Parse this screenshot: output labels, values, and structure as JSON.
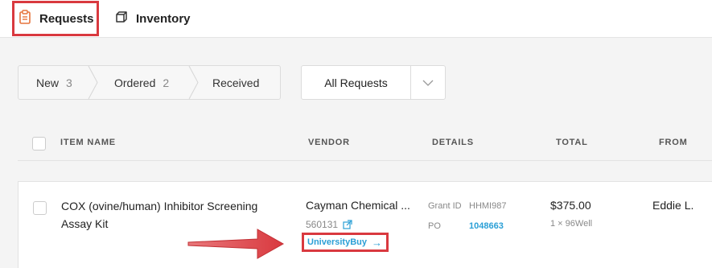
{
  "tabs": [
    {
      "label": "Requests",
      "icon": "clipboard-icon",
      "active": true
    },
    {
      "label": "Inventory",
      "icon": "box-icon",
      "active": false
    }
  ],
  "status_steps": [
    {
      "label": "New",
      "count": "3"
    },
    {
      "label": "Ordered",
      "count": "2"
    },
    {
      "label": "Received",
      "count": ""
    }
  ],
  "filter": {
    "selected": "All Requests"
  },
  "columns": {
    "item_name": "ITEM NAME",
    "vendor": "VENDOR",
    "details": "DETAILS",
    "total": "TOTAL",
    "from": "FROM"
  },
  "row": {
    "item_name": "COX (ovine/human) Inhibitor Screening Assay Kit",
    "vendor": "Cayman Chemical ...",
    "catalog_number": "560131",
    "vendor_link": "UniversityBuy",
    "grant_id_label": "Grant ID",
    "grant_id": "HHMI987",
    "po_label": "PO",
    "po": "1048663",
    "total": "$375.00",
    "quantity": "1 × 96Well",
    "from": "Eddie L."
  },
  "colors": {
    "accent": "#2a9fd6",
    "annotation": "#d9393f",
    "tab_icon": "#e6733c"
  }
}
